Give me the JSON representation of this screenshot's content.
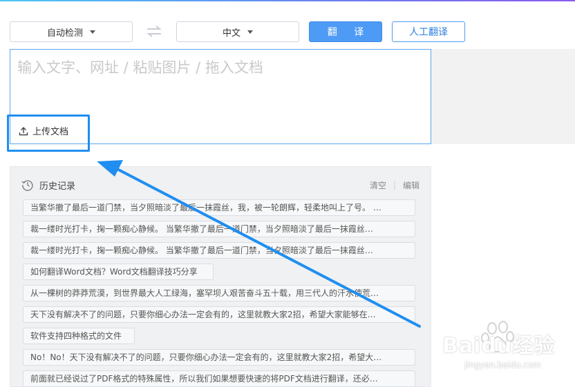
{
  "toolbar": {
    "source_lang": "自动检测",
    "target_lang": "中文",
    "translate_label": "翻 译",
    "human_translate_label": "人工翻译"
  },
  "input": {
    "placeholder": "输入文字、网址 / 粘贴图片 / 拖入文档",
    "upload_label": "上传文档"
  },
  "history": {
    "title": "历史记录",
    "clear_label": "清空",
    "edit_label": "编辑",
    "items": [
      "当繁华撤了最后一道门禁，当夕照暗淡了最后一抹霞丝，我，被一轮朗辉，轻柔地叫上了号。 …",
      "裁一缕时光打卡，掬一颗痴心静候。 当繁华撤了最后一道门禁，当夕照暗淡了最后一抹霞丝…",
      "裁一缕时光打卡，掬一颗痴心静候。 当繁华撤了最后一道门禁，当夕照暗淡了最后一抹霞丝…",
      "如何翻译Word文档？Word文档翻译技巧分享",
      "从一棵树的莽莽荒漠，到世界最大人工绿海，塞罕坝人艰苦奋斗五十载，用三代人的汗水使荒…",
      "天下没有解决不了的问题，只要你细心办法一定会有的，这里就教大家2招，希望大家能够在…",
      "软件支持四种格式的文件",
      "No！No！天下没有解决不了的问题，只要你细心办法一定会有的，这里就教大家2招，希望大…",
      "前面就已经说过了PDF格式的特殊属性，所以我们如果想要快速的将PDF文档进行翻译，还必…"
    ]
  },
  "watermark": {
    "brand": "Baidu经验",
    "url": "jingyan.baidu.com"
  },
  "colors": {
    "accent": "#4e9bf5",
    "annotation": "#1f8ef0"
  }
}
